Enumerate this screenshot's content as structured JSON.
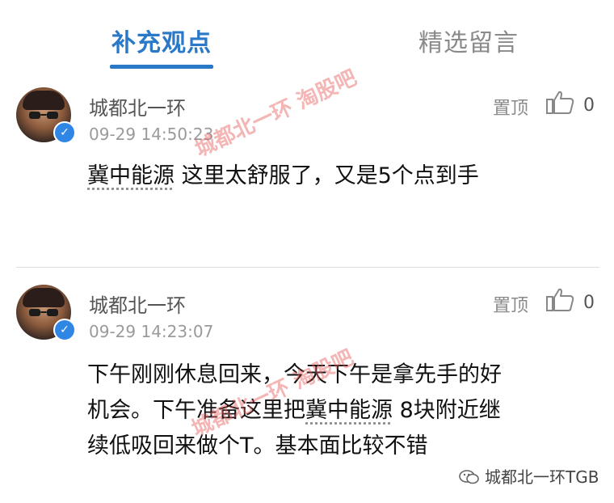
{
  "tabs": {
    "active": "补充观点",
    "inactive": "精选留言"
  },
  "comments": [
    {
      "username": "城都北一环",
      "time": "09-29 14:50:23",
      "pin": "置顶",
      "likes": "0",
      "text_before": "",
      "stock": "冀中能源",
      "text_after": " 这里太舒服了，又是5个点到手"
    },
    {
      "username": "城都北一环",
      "time": "09-29 14:23:07",
      "pin": "置顶",
      "likes": "0",
      "line1": "下午刚刚休息回来，今天下午是拿先手的好",
      "line2_before": "机会。下午准备这里把",
      "stock": "冀中能源",
      "line2_after": " 8块附近继",
      "line3": "续低吸回来做个T。基本面比较不错"
    }
  ],
  "watermarks": {
    "wm1": "城都北一环 淘股吧",
    "wm2": "城都北一环 淘股吧"
  },
  "footer": {
    "label": "城都北一环TGB"
  },
  "colors": {
    "accent": "#2a78c8",
    "verified": "#2f86e4"
  }
}
